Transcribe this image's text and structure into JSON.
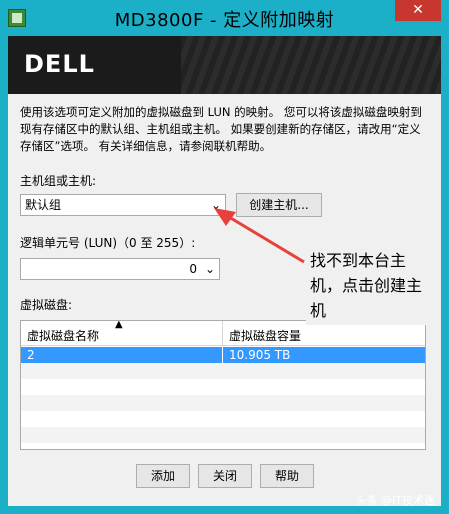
{
  "window": {
    "title": "MD3800F - 定义附加映射",
    "close_glyph": "✕"
  },
  "banner": {
    "logo": "DELL"
  },
  "description": "使用该选项可定义附加的虚拟磁盘到 LUN 的映射。 您可以将该虚拟磁盘映射到现有存储区中的默认组、主机组或主机。 如果要创建新的存储区，请改用“定义存储区”选项。 有关详细信息，请参阅联机帮助。",
  "host": {
    "label": "主机组或主机:",
    "selected": "默认组",
    "create_button": "创建主机..."
  },
  "lun": {
    "label": "逻辑单元号 (LUN)（0 至 255）:",
    "selected": "0"
  },
  "vdisk": {
    "label": "虚拟磁盘:",
    "columns": [
      "虚拟磁盘名称",
      "虚拟磁盘容量"
    ],
    "rows": [
      {
        "name": "2",
        "capacity": "10.905 TB"
      }
    ]
  },
  "buttons": {
    "add": "添加",
    "close": "关闭",
    "help": "帮助"
  },
  "annotation": "找不到本台主机，点击创建主机",
  "watermark": "头条 @IT技术迷",
  "icons": {
    "sort": "▲",
    "dropdown": "⌄"
  },
  "colors": {
    "title_bar": "#1bb0c7",
    "close_button": "#c7372f",
    "selection": "#3399ff",
    "arrow": "#e8413c"
  }
}
